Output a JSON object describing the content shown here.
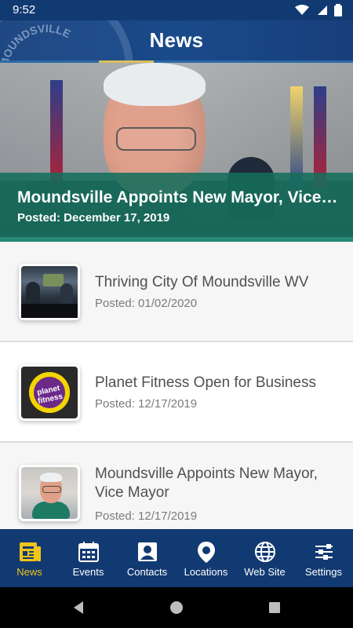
{
  "status_bar": {
    "time": "9:52",
    "icons": [
      "wifi-icon",
      "signal-icon",
      "battery-icon"
    ]
  },
  "header": {
    "title": "News",
    "seal_text": "MOUNDSVILLE"
  },
  "featured": {
    "title": "Moundsville Appoints New Mayor, Vice ...",
    "date": "Posted: December 17, 2019"
  },
  "news_items": [
    {
      "title": "Thriving City Of Moundsville WV",
      "date": "Posted: 01/02/2020"
    },
    {
      "title": "Planet Fitness Open for Business",
      "date": "Posted: 12/17/2019",
      "thumb_text": "planet fitness"
    },
    {
      "title": "Moundsville Appoints New Mayor, Vice Mayor",
      "date": "Posted: 12/17/2019"
    }
  ],
  "bottom_nav": {
    "active": "News",
    "items": [
      {
        "label": "News",
        "icon": "news-icon"
      },
      {
        "label": "Events",
        "icon": "calendar-icon"
      },
      {
        "label": "Contacts",
        "icon": "contacts-icon"
      },
      {
        "label": "Locations",
        "icon": "location-pin-icon"
      },
      {
        "label": "Web Site",
        "icon": "globe-icon"
      },
      {
        "label": "Settings",
        "icon": "settings-sliders-icon"
      }
    ]
  },
  "colors": {
    "primary": "#123a72",
    "accent": "#f0c419",
    "featured_overlay": "#166e5c"
  }
}
